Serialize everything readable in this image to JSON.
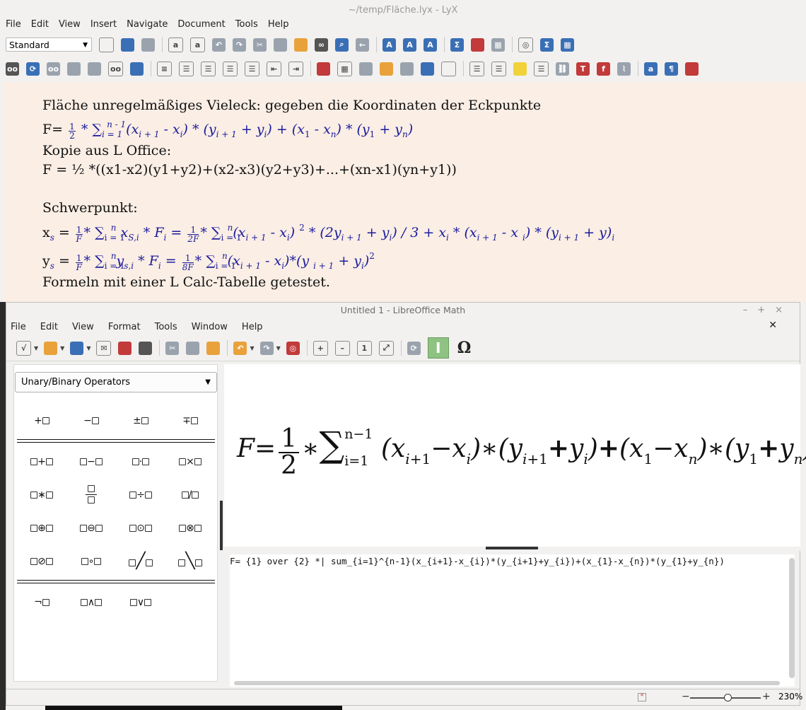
{
  "lyx": {
    "title": "~/temp/Fläche.lyx - LyX",
    "menu": [
      "File",
      "Edit",
      "View",
      "Insert",
      "Navigate",
      "Document",
      "Tools",
      "Help"
    ],
    "style_combo": "Standard",
    "doc": {
      "line1": "Fläche unregelmäßiges Vieleck: gegeben die Koordinaten der Eckpunkte",
      "line3": "Kopie aus L Office:",
      "line4": "F = ½ *((x1-x2)(y1+y2)+(x2-x3)(y2+y3)+...+(xn-x1)(yn+y1))",
      "line5": "Schwerpunkt:",
      "line8": "Formeln mit einer L Calc-Tabelle getestet."
    }
  },
  "math": {
    "title": "Untitled 1 - LibreOffice Math",
    "menu": [
      "File",
      "Edit",
      "View",
      "Format",
      "Tools",
      "Window",
      "Help"
    ],
    "panel_select": "Unary/Binary Operators",
    "formula_source": "F= {1} over {2} *| sum_{i=1}^{n-1}(x_{i+1}-x_{i})*(y_{i+1}+y_{i})+(x_{1}-x_{n})*(y_{1}+y_{n})",
    "zoom": "230%"
  }
}
